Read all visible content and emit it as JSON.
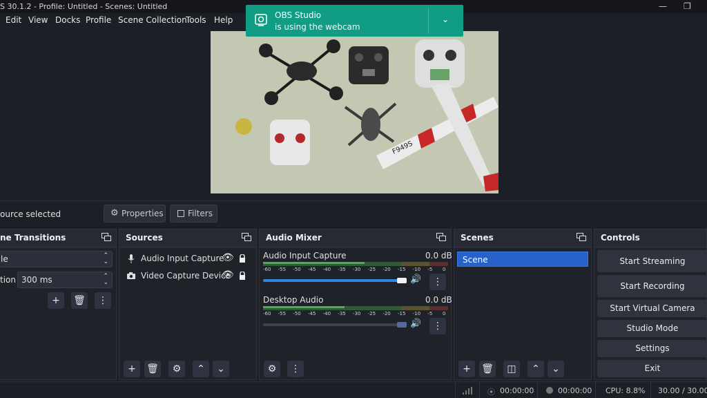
{
  "window": {
    "title": "S 30.1.2 - Profile: Untitled - Scenes: Untitled"
  },
  "menu": {
    "items": [
      "Edit",
      "View",
      "Docks",
      "Profile",
      "Scene Collection",
      "Tools",
      "Help"
    ]
  },
  "toast": {
    "title": "OBS Studio",
    "message": "is using the webcam"
  },
  "sourcebar": {
    "selection_text": "ource selected",
    "properties_label": "Properties",
    "filters_label": "Filters"
  },
  "transitions": {
    "title": "ne Transitions",
    "type_value": "le",
    "duration_label": "tion",
    "duration_value": "300 ms"
  },
  "sources": {
    "title": "Sources",
    "items": [
      {
        "label": "Audio Input Capture",
        "icon": "microphone-icon"
      },
      {
        "label": "Video Capture Device",
        "icon": "camera-icon"
      }
    ]
  },
  "mixer": {
    "title": "Audio Mixer",
    "channels": [
      {
        "name": "Audio Input Capture",
        "db": "0.0 dB",
        "volume": 1.0,
        "level": 0.55
      },
      {
        "name": "Desktop Audio",
        "db": "0.0 dB",
        "volume": 1.0,
        "level": 0.44
      }
    ],
    "ticks": [
      "-60",
      "-55",
      "-50",
      "-45",
      "-40",
      "-35",
      "-30",
      "-25",
      "-20",
      "-15",
      "-10",
      "-5",
      "0"
    ]
  },
  "scenes": {
    "title": "Scenes",
    "items": [
      "Scene"
    ]
  },
  "controls": {
    "title": "Controls",
    "buttons": [
      "Start Streaming",
      "Start Recording",
      "Start Virtual Camera",
      "Studio Mode",
      "Settings",
      "Exit"
    ]
  },
  "status": {
    "stream_time": "00:00:00",
    "record_time": "00:00:00",
    "cpu": "CPU: 8.8%",
    "fps": "30.00 / 30.00"
  },
  "colors": {
    "accent": "#2862c8",
    "toast": "#119c84",
    "meter_green": "#4caf50",
    "meter_yellow": "#c8b43c",
    "meter_red": "#b04040"
  }
}
